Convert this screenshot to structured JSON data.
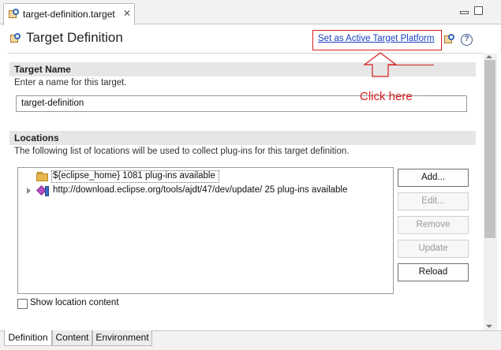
{
  "editor_tab": {
    "title": "target-definition.target",
    "close_glyph": "✕",
    "icon": "target-file-icon"
  },
  "form": {
    "title": "Target Definition",
    "icon": "target-definition-icon",
    "set_active_link": "Set as Active Target Platform",
    "help_glyph": "?"
  },
  "target_name": {
    "title": "Target Name",
    "description": "Enter a name for this target.",
    "value": "target-definition"
  },
  "annotation": {
    "text": "Click here",
    "color": "#d61f1f"
  },
  "locations": {
    "title": "Locations",
    "description": "The following list of locations will be used to collect plug-ins for this target definition.",
    "items": [
      {
        "label": "${eclipse_home} 1081 plug-ins available",
        "icon": "folder-icon"
      },
      {
        "label": "http://download.eclipse.org/tools/ajdt/47/dev/update/ 25 plug-ins available",
        "icon": "update-site-icon"
      }
    ],
    "buttons": {
      "add": "Add...",
      "edit": "Edit...",
      "remove": "Remove",
      "update": "Update",
      "reload": "Reload"
    },
    "show_content_label": "Show location content"
  },
  "bottom_tabs": [
    "Definition",
    "Content",
    "Environment"
  ]
}
